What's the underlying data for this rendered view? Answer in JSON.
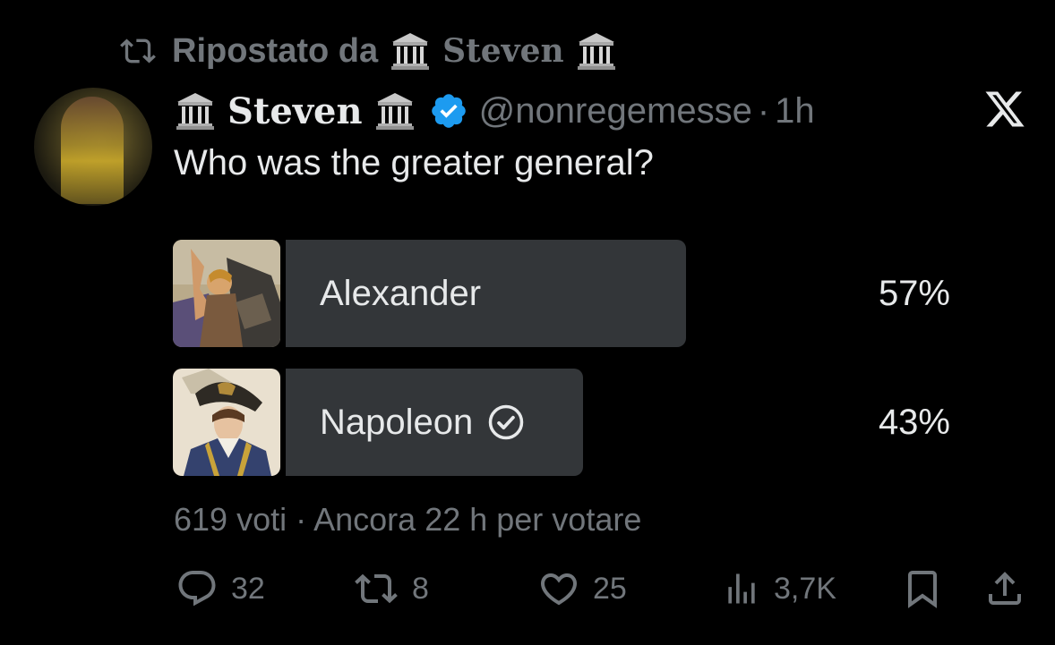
{
  "repost": {
    "prefix": "Ripostato da",
    "name": "Steven"
  },
  "author": {
    "display_name": "Steven",
    "handle": "@nonregemesse",
    "separator": "·",
    "time": "1h"
  },
  "tweet": {
    "text": "Who was the greater general?"
  },
  "poll": {
    "options": [
      {
        "label": "Alexander",
        "percent_text": "57%",
        "percent": 57,
        "selected": false
      },
      {
        "label": "Napoleon",
        "percent_text": "43%",
        "percent": 43,
        "selected": true
      }
    ],
    "votes": "619 voti",
    "meta_separator": "·",
    "remaining": "Ancora 22 h per votare"
  },
  "actions": {
    "replies": "32",
    "reposts": "8",
    "likes": "25",
    "views": "3,7K"
  },
  "colors": {
    "background": "#000000",
    "text": "#e7e9ea",
    "muted": "#71767b",
    "poll_bar": "#333639",
    "verified_blue": "#1d9bf0"
  },
  "icons": [
    "repost-icon",
    "temple-icon",
    "verified-badge-icon",
    "x-logo-icon",
    "check-circle-icon",
    "reply-icon",
    "like-icon",
    "views-icon",
    "bookmark-icon",
    "share-icon"
  ]
}
